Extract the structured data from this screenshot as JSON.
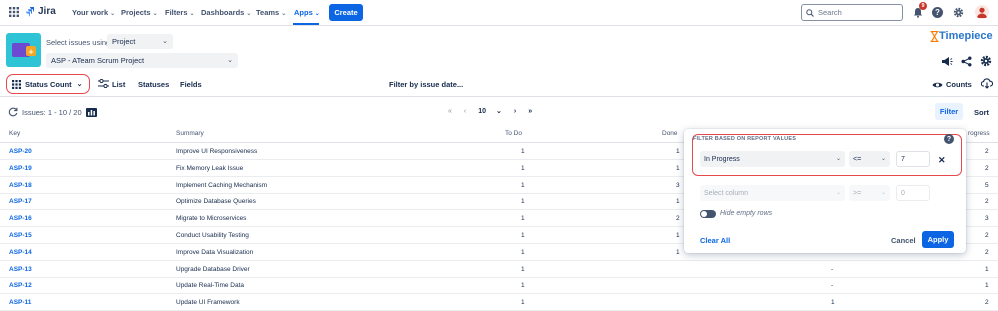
{
  "nav": {
    "brand": "Jira",
    "items": [
      {
        "label": "Your work"
      },
      {
        "label": "Projects"
      },
      {
        "label": "Filters"
      },
      {
        "label": "Dashboards"
      },
      {
        "label": "Teams"
      },
      {
        "label": "Apps"
      }
    ],
    "create": "Create",
    "search_placeholder": "Search",
    "notification_count": "9"
  },
  "toolbar": {
    "select_issues_label": "Select issues using",
    "select_mode": "Project",
    "project": "ASP - ATeam Scrum Project",
    "brand": "Timepiece",
    "status_count": "Status Count",
    "tabs": [
      "List",
      "Statuses",
      "Fields"
    ],
    "filter_by_date": "Filter by issue date...",
    "counts": "Counts"
  },
  "issues": {
    "label": "Issues: 1 - 10 / 20",
    "page_size": "10",
    "filter_button": "Filter",
    "sort_button": "Sort"
  },
  "table": {
    "headers": {
      "key": "Key",
      "summary": "Summary",
      "todo": "To Do",
      "done": "Done",
      "inprogress": "rogress"
    },
    "rows": [
      {
        "key": "ASP-20",
        "summary": "Improve UI Responsiveness",
        "todo": "1",
        "done": "1",
        "mid": "",
        "inprog": "2"
      },
      {
        "key": "ASP-19",
        "summary": "Fix Memory Leak Issue",
        "todo": "1",
        "done": "1",
        "mid": "",
        "inprog": "2"
      },
      {
        "key": "ASP-18",
        "summary": "Implement Caching Mechanism",
        "todo": "1",
        "done": "3",
        "mid": "",
        "inprog": "5"
      },
      {
        "key": "ASP-17",
        "summary": "Optimize Database Queries",
        "todo": "1",
        "done": "1",
        "mid": "",
        "inprog": "2"
      },
      {
        "key": "ASP-16",
        "summary": "Migrate to Microservices",
        "todo": "1",
        "done": "2",
        "mid": "",
        "inprog": "3"
      },
      {
        "key": "ASP-15",
        "summary": "Conduct Usability Testing",
        "todo": "1",
        "done": "1",
        "mid": "",
        "inprog": "2"
      },
      {
        "key": "ASP-14",
        "summary": "Improve Data Visualization",
        "todo": "1",
        "done": "1",
        "mid": "",
        "inprog": "2"
      },
      {
        "key": "ASP-13",
        "summary": "Upgrade Database Driver",
        "todo": "1",
        "done": "",
        "mid": "-",
        "inprog": "1"
      },
      {
        "key": "ASP-12",
        "summary": "Update Real-Time Data",
        "todo": "1",
        "done": "",
        "mid": "-",
        "inprog": "1"
      },
      {
        "key": "ASP-11",
        "summary": "Update UI Framework",
        "todo": "1",
        "done": "",
        "mid": "1",
        "inprog": "2"
      }
    ]
  },
  "filter_panel": {
    "title": "FILTER BASED ON REPORT VALUES",
    "row1": {
      "column": "In Progress",
      "operator": "<=",
      "value": "7"
    },
    "row2": {
      "column_placeholder": "Select column",
      "operator": ">=",
      "value": "0"
    },
    "hide_empty": "Hide empty rows",
    "clear_all": "Clear All",
    "cancel": "Cancel",
    "apply": "Apply"
  },
  "colors": {
    "accent": "#0c66e4",
    "highlight": "#e5484d",
    "brand_orange": "#ff7a00"
  }
}
